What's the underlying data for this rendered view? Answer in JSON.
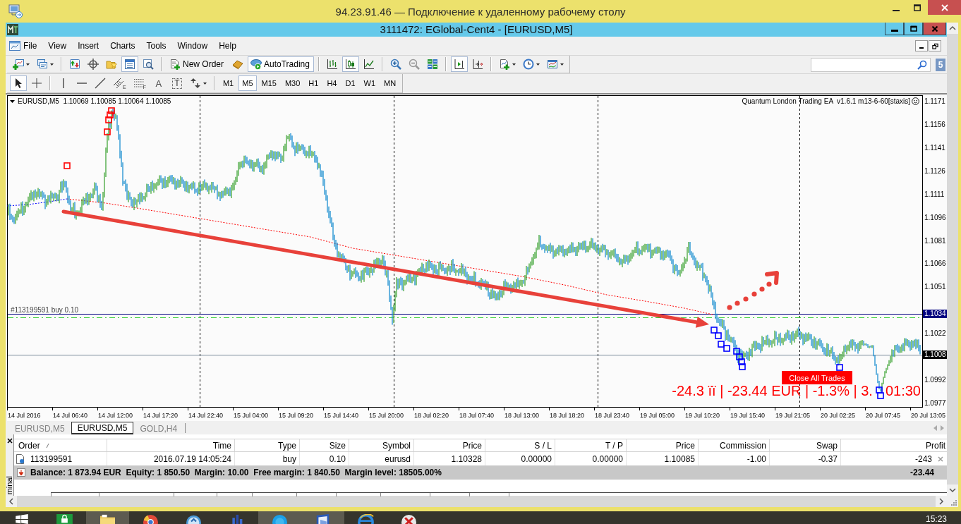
{
  "rdp_window": {
    "title": "94.23.91.46 — Подключение к удаленному рабочему столу"
  },
  "app_window": {
    "title": "3111472: EGlobal-Cent4 - [EURUSD,M5]"
  },
  "menu": [
    "File",
    "View",
    "Insert",
    "Charts",
    "Tools",
    "Window",
    "Help"
  ],
  "toolbar": [
    [
      {
        "kind": "newchart",
        "on": false,
        "dropdown": true
      },
      {
        "kind": "profiles",
        "on": false,
        "dropdown": true
      }
    ],
    [
      {
        "kind": "marketwatch",
        "on": false
      },
      {
        "kind": "datawindow",
        "on": false
      },
      {
        "kind": "navigator",
        "on": false
      },
      {
        "kind": "terminal",
        "on": true
      },
      {
        "kind": "tester",
        "on": false
      }
    ],
    [
      {
        "kind": "neworder",
        "label": "New Order",
        "on": false
      },
      {
        "kind": "editor",
        "on": false
      },
      {
        "kind": "autotrading",
        "label": "AutoTrading",
        "on": true
      }
    ],
    [
      {
        "kind": "bars",
        "on": false
      },
      {
        "kind": "candles",
        "on": true
      },
      {
        "kind": "line",
        "on": false
      }
    ],
    [
      {
        "kind": "zoomin",
        "on": false
      },
      {
        "kind": "zoomout",
        "on": false
      },
      {
        "kind": "tile",
        "on": false
      }
    ],
    [
      {
        "kind": "shift",
        "on": true
      },
      {
        "kind": "autoscroll",
        "on": false
      }
    ],
    [
      {
        "kind": "indicators",
        "on": false,
        "dropdown": true
      },
      {
        "kind": "periods",
        "on": false,
        "dropdown": true
      },
      {
        "kind": "templates",
        "on": false,
        "dropdown": true
      }
    ]
  ],
  "message_badge": "5",
  "drawing_tools": [
    [
      {
        "kind": "cursor",
        "selected": true
      },
      {
        "kind": "crosshair",
        "selected": false
      }
    ],
    [
      {
        "kind": "vline",
        "selected": false
      },
      {
        "kind": "hline",
        "selected": false
      },
      {
        "kind": "trend",
        "selected": false
      },
      {
        "kind": "channel",
        "glyph": "E",
        "selected": false
      },
      {
        "kind": "fibo",
        "glyph": "F",
        "selected": false
      },
      {
        "kind": "text",
        "glyph": "A",
        "selected": false
      },
      {
        "kind": "label",
        "glyph": "T",
        "selected": false
      },
      {
        "kind": "arrows",
        "selected": false,
        "dropdown": true
      }
    ]
  ],
  "timeframes": [
    {
      "label": "M1",
      "selected": false
    },
    {
      "label": "M5",
      "selected": true
    },
    {
      "label": "M15",
      "selected": false
    },
    {
      "label": "M30",
      "selected": false
    },
    {
      "label": "H1",
      "selected": false
    },
    {
      "label": "H4",
      "selected": false
    },
    {
      "label": "D1",
      "selected": false
    },
    {
      "label": "W1",
      "selected": false
    },
    {
      "label": "MN",
      "selected": false
    }
  ],
  "chart": {
    "symbol_info": "EURUSD,M5  1.10069 1.10085 1.10064 1.10085",
    "expert_label": "Quantum London Trading EA  v1.6.1 m13-6-60[staxis]",
    "order_label": "#113199591 buy 0.10",
    "close_button": "Close All Trades",
    "status_text": "-24.3 ïï | -23.44 EUR | -1.3% | 3.",
    "status_time": "01:30",
    "price_ticks": [
      "1.1171",
      "1.1156",
      "1.1141",
      "1.1126",
      "1.1111",
      "1.1096",
      "1.1081",
      "1.1066",
      "1.1051",
      "1.1022",
      "1.0992",
      "1.0977"
    ],
    "order_price": "1.1034",
    "current_price": "1.1008",
    "time_ticks": [
      "14 Jul 2016",
      "14 Jul 06:40",
      "14 Jul 12:00",
      "14 Jul 17:20",
      "14 Jul 22:40",
      "15 Jul 04:00",
      "15 Jul 09:20",
      "15 Jul 14:40",
      "15 Jul 20:00",
      "18 Jul 02:20",
      "18 Jul 07:40",
      "18 Jul 13:00",
      "18 Jul 18:20",
      "18 Jul 23:40",
      "19 Jul 05:00",
      "19 Jul 10:20",
      "19 Jul 15:40",
      "19 Jul 21:05",
      "20 Jul 02:25",
      "20 Jul 07:45",
      "20 Jul 13:05"
    ]
  },
  "chart_tabs": [
    {
      "label": "EURUSD,M5",
      "selected": false
    },
    {
      "label": "EURUSD,M5",
      "selected": true
    },
    {
      "label": "GOLD,H4",
      "selected": false
    }
  ],
  "terminal": {
    "side_label": "minal",
    "columns": [
      "Order",
      "Time",
      "Type",
      "Size",
      "Symbol",
      "Price",
      "S / L",
      "T / P",
      "Price",
      "Commission",
      "Swap",
      "Profit"
    ],
    "rows": [
      {
        "cells": [
          "113199591",
          "2016.07.19 14:05:24",
          "buy",
          "0.10",
          "eurusd",
          "1.10328",
          "0.00000",
          "0.00000",
          "1.10085",
          "-1.00",
          "-0.37",
          "-243"
        ]
      }
    ],
    "summary": {
      "text": "Balance: 1 873.94 EUR  Equity: 1 850.50  Margin: 10.00  Free margin: 1 840.50  Margin level: 18505.00%",
      "total": "-23.44"
    }
  },
  "taskbar": {
    "apps": [
      {
        "kind": "store",
        "active": false
      },
      {
        "kind": "folder",
        "active": true
      },
      {
        "kind": "browser",
        "active": false
      },
      {
        "kind": "remote",
        "active": false
      },
      {
        "kind": "chart",
        "active": false
      },
      {
        "kind": "cloud",
        "active": true
      },
      {
        "kind": "window",
        "active": true
      },
      {
        "kind": "globe",
        "active": false
      },
      {
        "kind": "cross",
        "active": false
      }
    ],
    "clock": "15:23"
  }
}
